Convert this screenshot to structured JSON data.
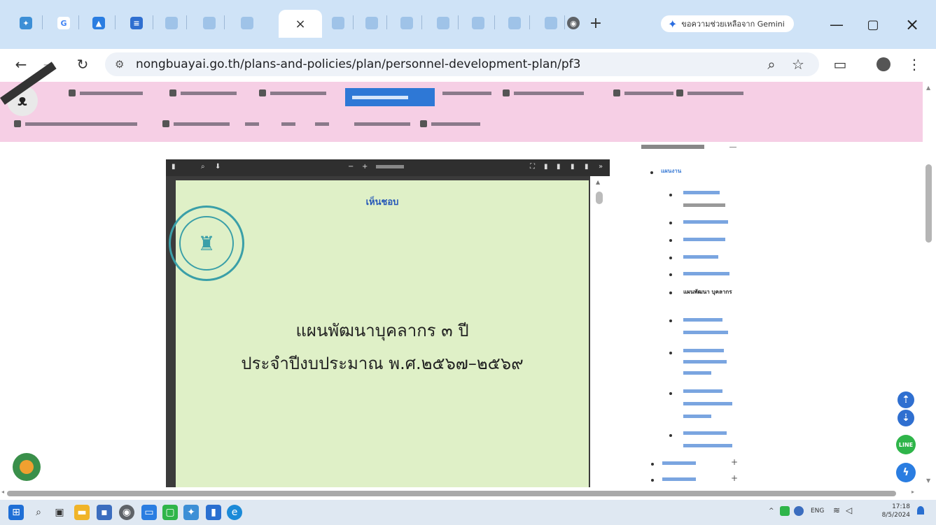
{
  "browser": {
    "gemini_label": "ขอความช่วยเหลือจาก Gemini",
    "close_tab_glyph": "×",
    "new_tab_glyph": "+",
    "url": "nongbuayai.go.th/plans-and-policies/plan/personnel-development-plan/pf3"
  },
  "pdf": {
    "stamp_text": "เห็นชอบ",
    "title_line1": "แผนพัฒนาบุคลากร ๓ ปี",
    "title_line2": "ประจำปีงบประมาณ พ.ศ.๒๕๖๗–๒๕๖๙"
  },
  "sidebar": {
    "items": [
      "แผนงาน",
      "แผนพัฒนา บุคลากร"
    ]
  },
  "taskbar": {
    "lang": "ENG",
    "time": "17:18",
    "date": "8/5/2024"
  },
  "colors": {
    "tabbar": "#cfe3f7",
    "site_nav": "#f6cfe5",
    "pdf_page": "#dff0c7",
    "accent": "#2e78d6"
  }
}
